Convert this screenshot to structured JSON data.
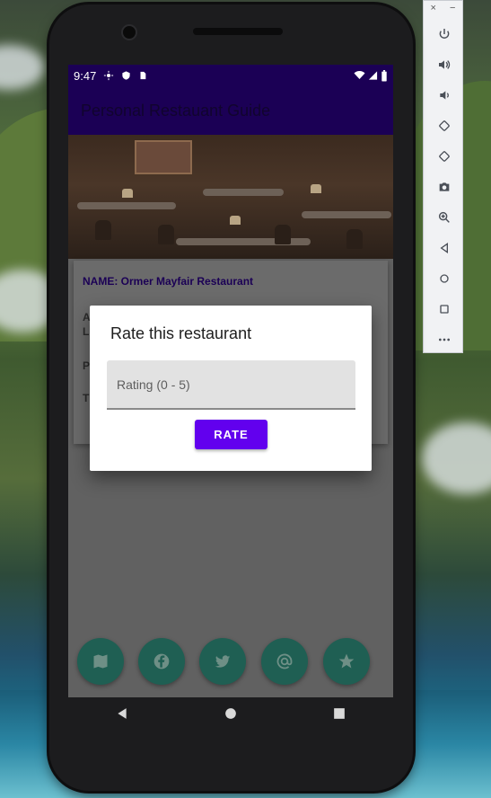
{
  "status_bar": {
    "time": "9:47"
  },
  "app_bar": {
    "title": "Personal Restauant Guide"
  },
  "details": {
    "name": "NAME: Ormer Mayfair Restaurant",
    "line_a": "A",
    "line_l": "L",
    "line_p": "P",
    "line_t": "T"
  },
  "dialog": {
    "title": "Rate this restaurant",
    "rating_placeholder": "Rating (0 - 5)",
    "rate_button": "RATE"
  },
  "fabs": [
    "map-icon",
    "facebook-icon",
    "twitter-icon",
    "email-icon",
    "star-icon"
  ],
  "emulator_toolbar": [
    "power-icon",
    "volume-up-icon",
    "volume-down-icon",
    "rotate-left-icon",
    "rotate-right-icon",
    "camera-icon",
    "zoom-icon",
    "back-icon",
    "home-icon",
    "overview-icon",
    "more-icon"
  ],
  "colors": {
    "primary": "#1b0055",
    "button": "#6200ee",
    "fab": "#1f5f53"
  }
}
